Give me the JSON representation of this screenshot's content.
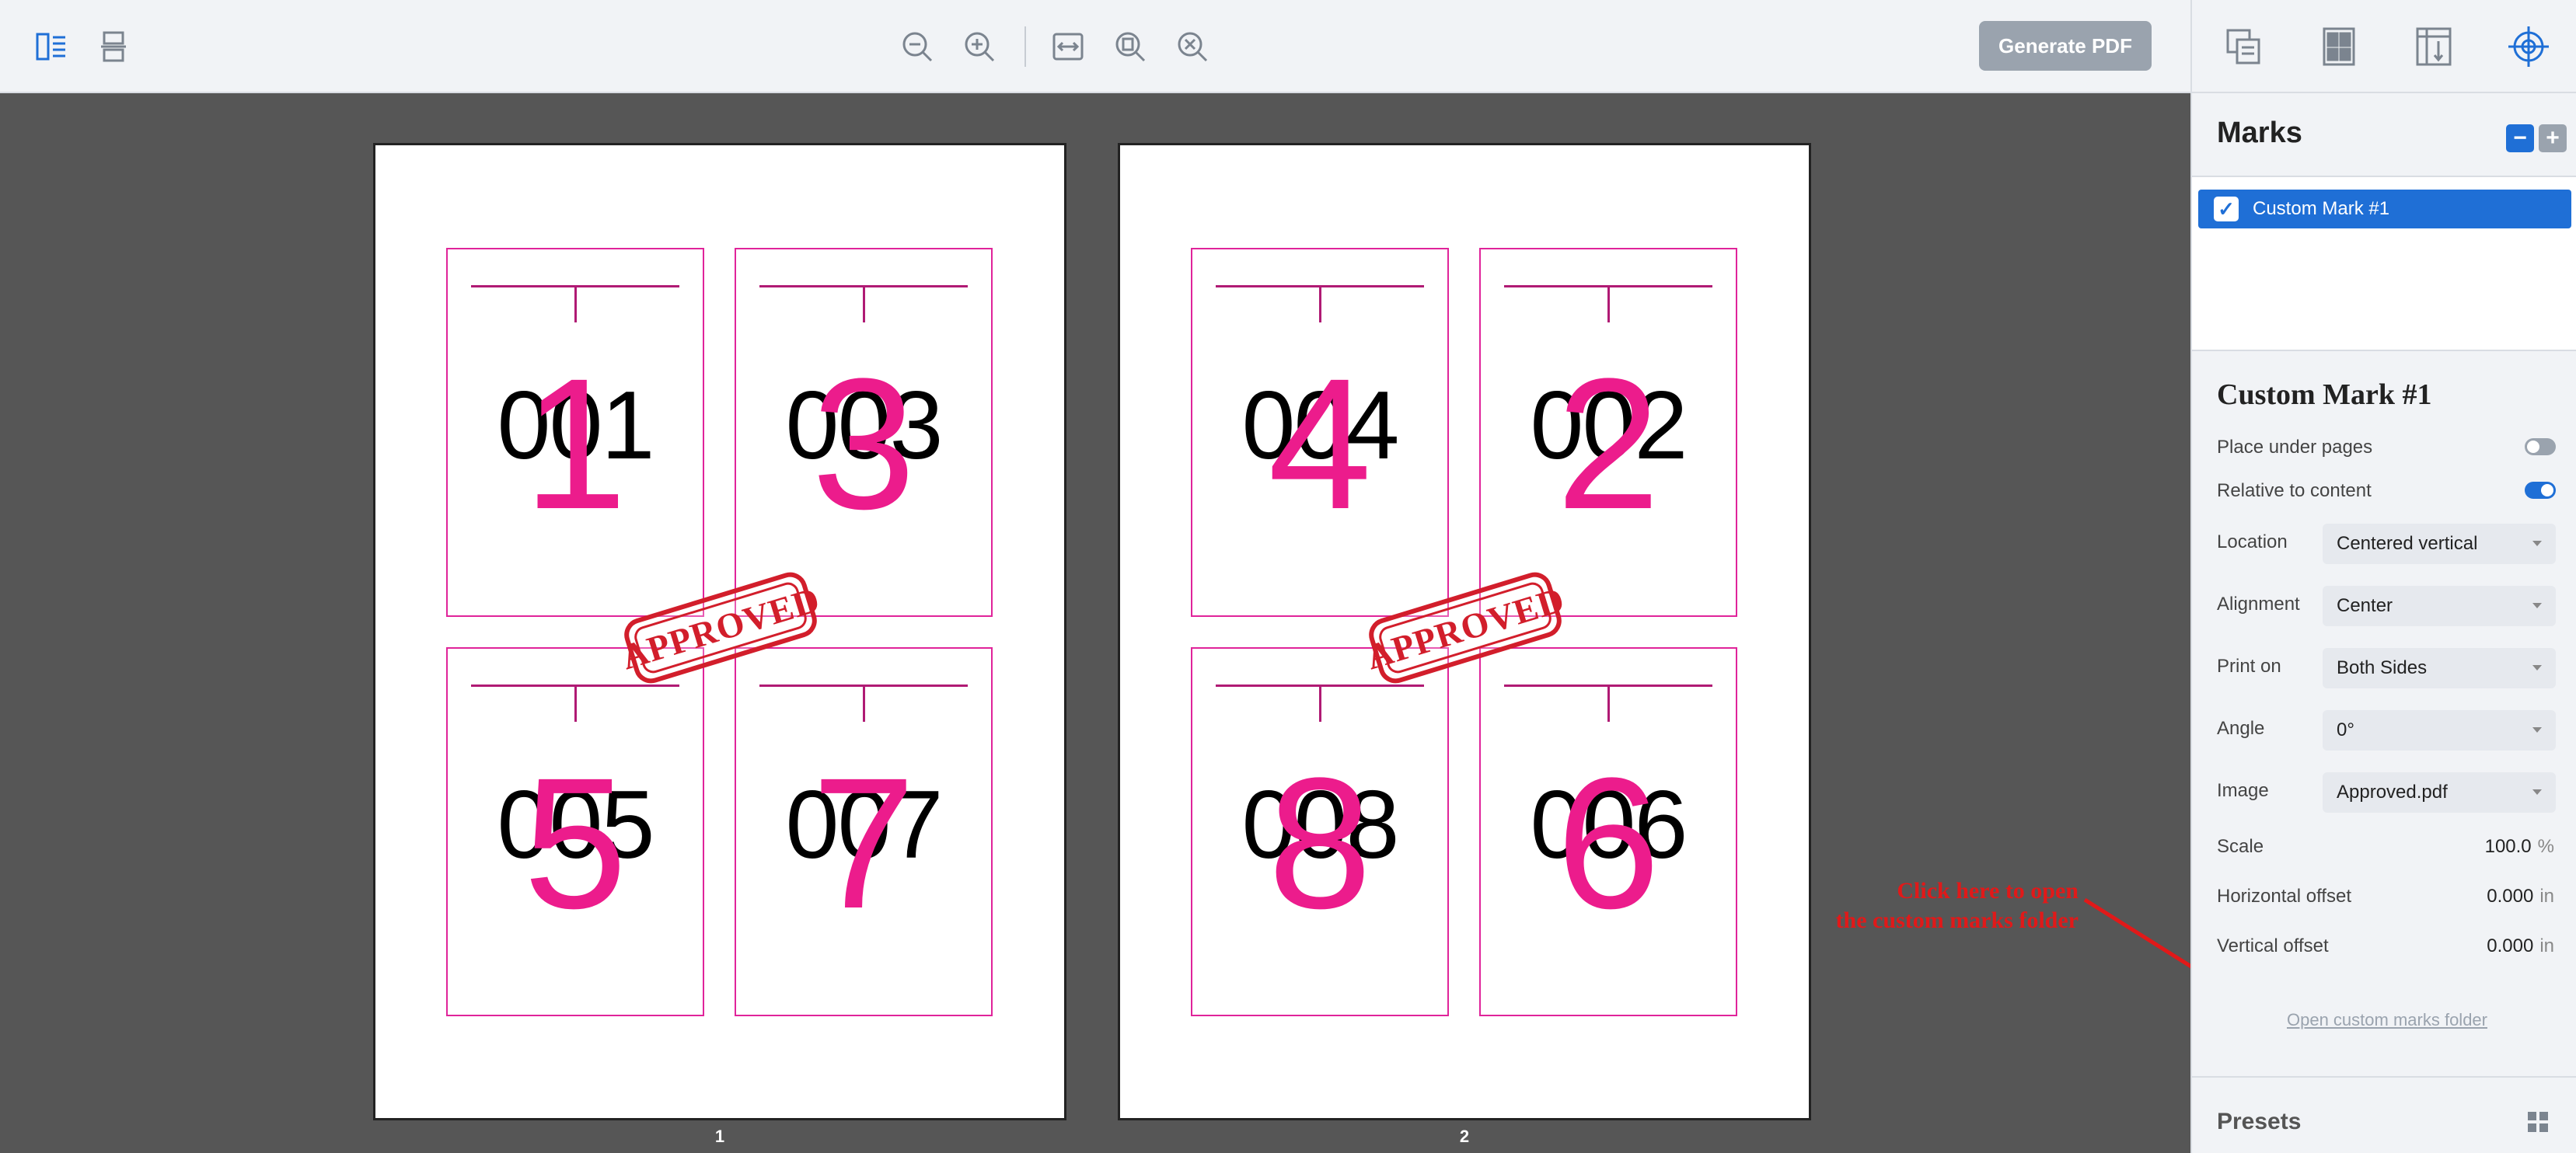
{
  "toolbar": {
    "generate_label": "Generate PDF",
    "icons": [
      "view-columns-icon",
      "view-rows-icon",
      "zoom-out-icon",
      "zoom-in-icon",
      "fit-width-icon",
      "zoom-page-icon",
      "zoom-reset-icon"
    ]
  },
  "sheets": [
    {
      "label": "1",
      "cards": [
        {
          "number": "001",
          "order": "1"
        },
        {
          "number": "003",
          "order": "3"
        },
        {
          "number": "005",
          "order": "5"
        },
        {
          "number": "007",
          "order": "7"
        }
      ],
      "stamp": "APPROVED"
    },
    {
      "label": "2",
      "cards": [
        {
          "number": "004",
          "order": "4"
        },
        {
          "number": "002",
          "order": "2"
        },
        {
          "number": "008",
          "order": "8"
        },
        {
          "number": "006",
          "order": "6"
        }
      ],
      "stamp": "APPROVED"
    }
  ],
  "annotation": {
    "line1": "Click here to open",
    "line2": "the custom marks folder",
    "color": "#e11919"
  },
  "panel": {
    "tabs": [
      "pages-tab-icon",
      "layout-tab-icon",
      "size-tab-icon",
      "marks-tab-icon"
    ],
    "marks_title": "Marks",
    "marks": [
      {
        "label": "Custom Mark #1",
        "checked": true
      }
    ],
    "prop_title": "Custom Mark #1",
    "place_under_pages": {
      "label": "Place under pages",
      "on": false
    },
    "relative_to_content": {
      "label": "Relative to content",
      "on": true
    },
    "location": {
      "label": "Location",
      "value": "Centered vertical"
    },
    "alignment": {
      "label": "Alignment",
      "value": "Center"
    },
    "print_on": {
      "label": "Print on",
      "value": "Both Sides"
    },
    "angle": {
      "label": "Angle",
      "value": "0°"
    },
    "image": {
      "label": "Image",
      "value": "Approved.pdf"
    },
    "scale": {
      "label": "Scale",
      "value": "100.0",
      "unit": "%"
    },
    "horizontal_offset": {
      "label": "Horizontal offset",
      "value": "0.000",
      "unit": "in"
    },
    "vertical_offset": {
      "label": "Vertical offset",
      "value": "0.000",
      "unit": "in"
    },
    "open_folder_link": "Open custom marks folder",
    "presets_label": "Presets"
  },
  "colors": {
    "accent": "#1f6fd6",
    "mark_magenta": "#ec1c8c",
    "stamp_red": "#d21e2b",
    "canvas": "#565656"
  }
}
